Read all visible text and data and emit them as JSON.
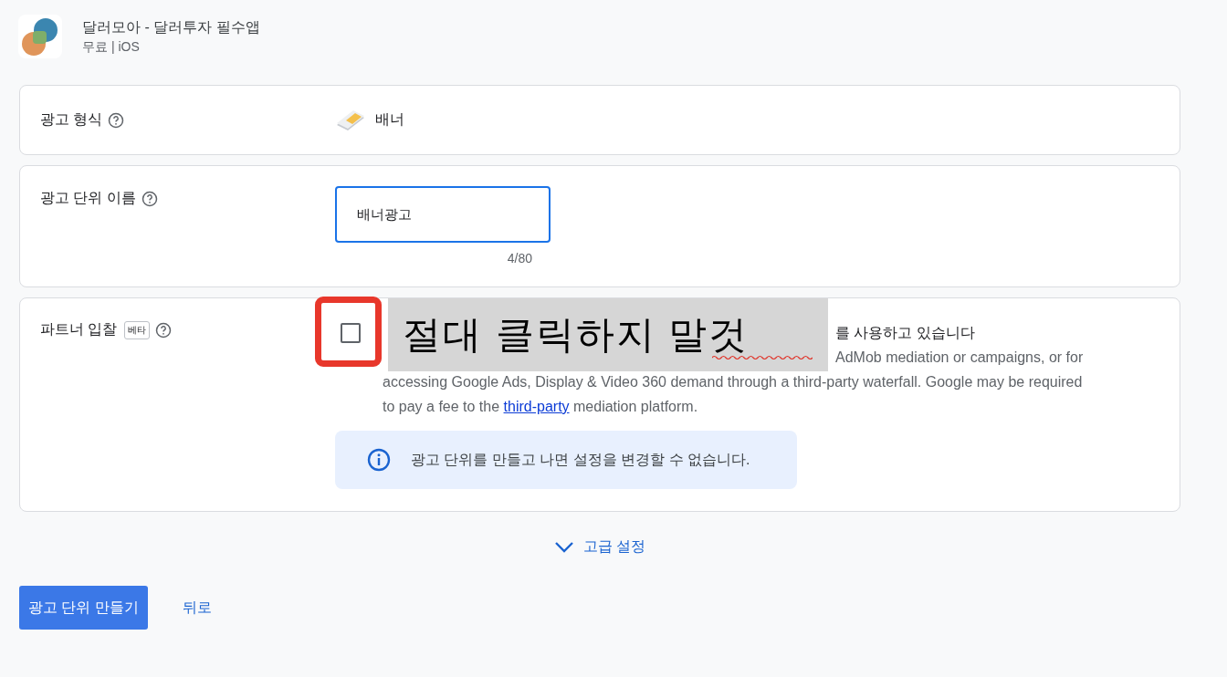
{
  "app": {
    "name": "달러모아 - 달러투자 필수앱",
    "meta": "무료 | iOS"
  },
  "ad_format": {
    "label": "광고 형식",
    "value": "배너"
  },
  "ad_unit_name": {
    "label": "광고 단위 이름",
    "value": "배너광고",
    "counter": "4/80"
  },
  "partner_bidding": {
    "label": "파트너 입찰",
    "badge": "베타",
    "checked": false,
    "title_visible": "를 사용하고 있습니다",
    "description_lines": [
      "AdMob mediation or campaigns, or for",
      "accessing Google Ads, Display & Video 360 demand through a third-party waterfall. Google may be required"
    ],
    "last_line": {
      "before": "to pay a fee to the ",
      "link": "third-party",
      "after": " mediation platform."
    },
    "notice": "광고 단위를 만들고 나면 설정을 변경할 수 없습니다."
  },
  "advanced": {
    "label": "고급 설정",
    "expanded": false
  },
  "buttons": {
    "create": "광고 단위 만들기",
    "back": "뒤로"
  },
  "annotation": {
    "text": "절대 클릭하지 말것"
  }
}
